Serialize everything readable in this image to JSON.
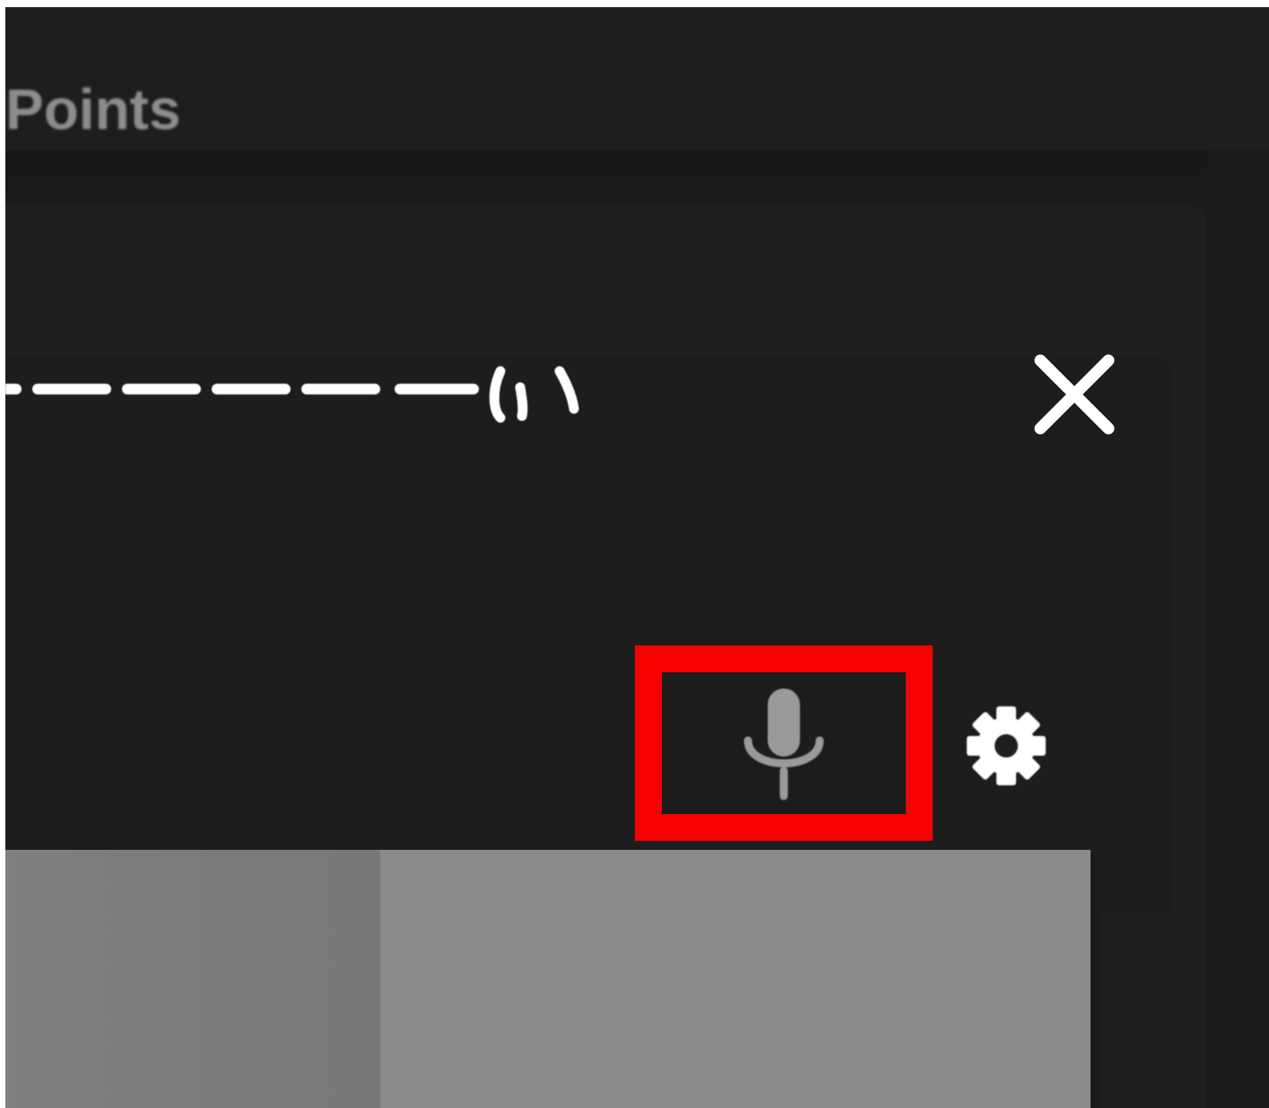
{
  "header": {
    "title": "Points"
  },
  "dialog": {
    "title_glyphs": "い",
    "close_icon": "close-icon"
  },
  "toolbar": {
    "mic_icon": "microphone-icon",
    "settings_icon": "gear-icon",
    "highlight_color": "#f70000"
  },
  "colors": {
    "background": "#1b1b1b",
    "panel": "#1f1f1f",
    "text_dim": "#8d8d8d",
    "icon_white": "#ffffff",
    "icon_gray": "#9a9a9a",
    "preview_left": "#7c7c7c",
    "preview_right": "#8b8b8b"
  }
}
